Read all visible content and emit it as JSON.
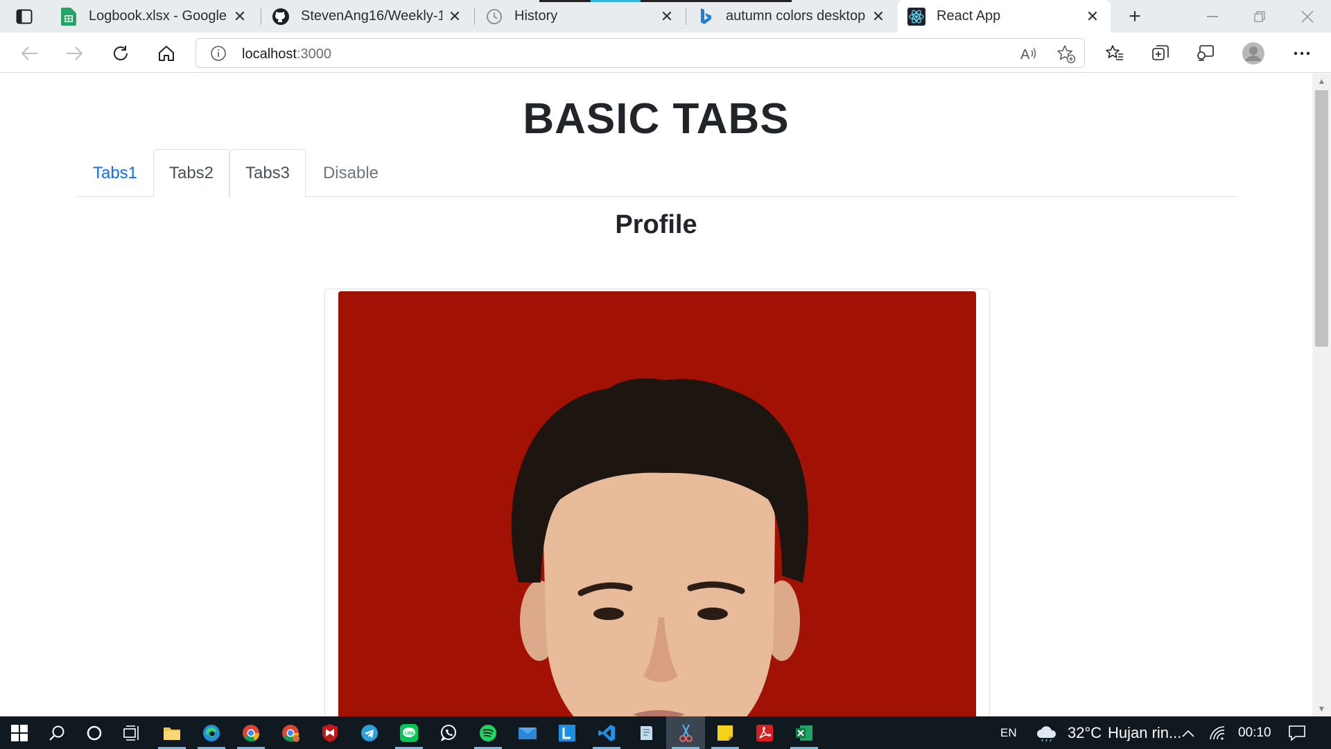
{
  "browser": {
    "tabs": [
      {
        "title": "Logbook.xlsx - Google Sh",
        "icon": "google-sheets-icon",
        "color": "#23a566"
      },
      {
        "title": "StevenAng16/Weekly-1",
        "icon": "github-icon",
        "color": "#1b1f23"
      },
      {
        "title": "History",
        "icon": "history-icon",
        "color": "#888888"
      },
      {
        "title": "autumn colors desktop - B",
        "icon": "bing-icon",
        "color": "#1f7fd6"
      },
      {
        "title": "React App",
        "icon": "react-icon",
        "color": "#61dafb",
        "active": true
      }
    ],
    "new_tab_label": "+",
    "address": {
      "host": "localhost",
      "port": ":3000"
    }
  },
  "page": {
    "title": "BASIC TABS",
    "tabs": [
      {
        "label": "Tabs1",
        "state": "link"
      },
      {
        "label": "Tabs2",
        "state": "bordered"
      },
      {
        "label": "Tabs3",
        "state": "bordered"
      },
      {
        "label": "Disable",
        "state": "disabled"
      }
    ],
    "section_heading": "Profile",
    "photo_background": "#a11204"
  },
  "taskbar": {
    "language": "EN",
    "temperature": "32°C",
    "weather": "Hujan rin...",
    "time": "00:10"
  },
  "colors": {
    "link": "#0d6efd",
    "tab_text": "#495057",
    "disabled": "#6c757d",
    "heading": "#212529",
    "taskbar_bg": "#101820"
  }
}
